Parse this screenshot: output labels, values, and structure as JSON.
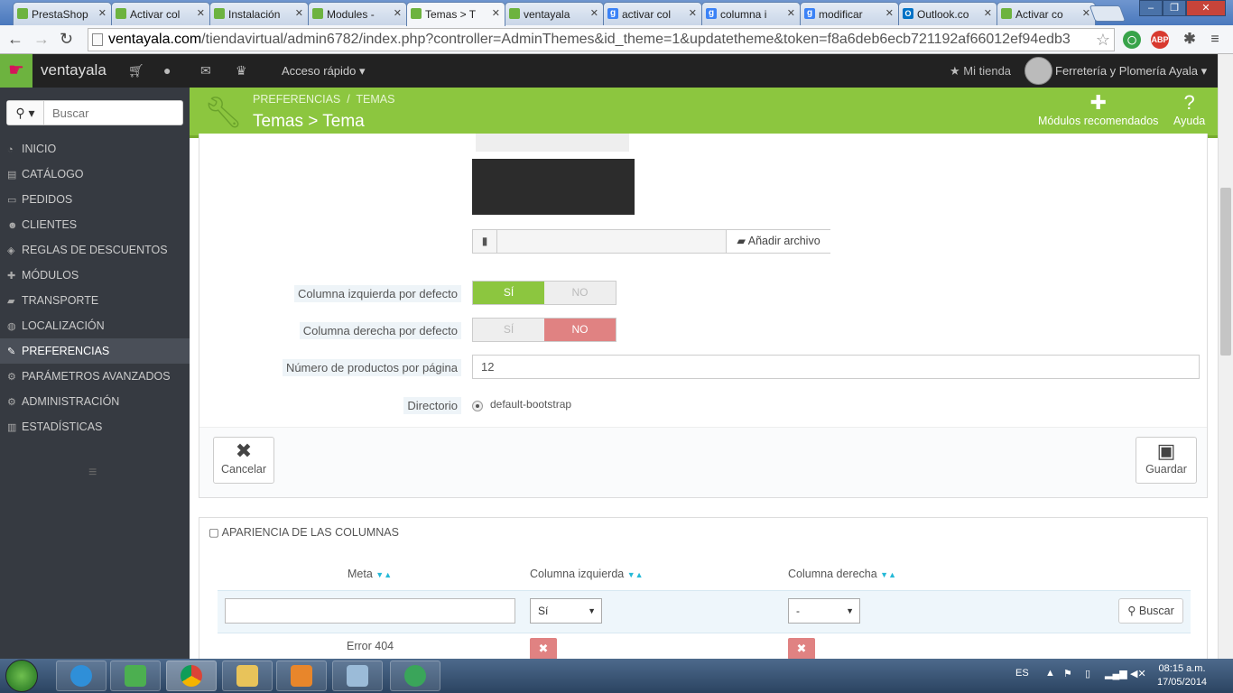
{
  "browser": {
    "tabs": [
      {
        "label": "PrestaShop",
        "favicon": "prestashop-icon",
        "active": false
      },
      {
        "label": "Activar col",
        "favicon": "prestashop-icon",
        "active": false
      },
      {
        "label": "Instalación",
        "favicon": "prestashop-icon",
        "active": false
      },
      {
        "label": "Modules -",
        "favicon": "prestashop-icon",
        "active": false
      },
      {
        "label": "Temas > T",
        "favicon": "prestashop-icon",
        "active": true
      },
      {
        "label": "ventayala",
        "favicon": "prestashop-icon",
        "active": false
      },
      {
        "label": "activar col",
        "favicon": "google-icon",
        "active": false
      },
      {
        "label": "columna i",
        "favicon": "google-icon",
        "active": false
      },
      {
        "label": "modificar",
        "favicon": "google-icon",
        "active": false
      },
      {
        "label": "Outlook.co",
        "favicon": "outlook-icon",
        "active": false
      },
      {
        "label": "Activar co",
        "favicon": "prestashop-icon",
        "active": false
      }
    ],
    "url_domain": "ventayala.com",
    "url_rest": "/tiendavirtual/admin6782/index.php?controller=AdminThemes&id_theme=1&updatetheme&token=f8a6deb6ecb721192af66012ef94edb3",
    "ext_abp": "ABP"
  },
  "header": {
    "shop_name": "ventayala",
    "quick_access": "Acceso rápido",
    "my_shop": "Mi tienda",
    "employee": "Ferretería y Plomería Ayala"
  },
  "sidebar": {
    "search_placeholder": "Buscar",
    "items": [
      {
        "label": "INICIO",
        "icon": "dashboard-icon",
        "active": false
      },
      {
        "label": "CATÁLOGO",
        "icon": "book-icon",
        "active": false
      },
      {
        "label": "PEDIDOS",
        "icon": "credit-card-icon",
        "active": false
      },
      {
        "label": "CLIENTES",
        "icon": "users-icon",
        "active": false
      },
      {
        "label": "REGLAS DE DESCUENTOS",
        "icon": "tag-icon",
        "active": false
      },
      {
        "label": "MÓDULOS",
        "icon": "puzzle-icon",
        "active": false
      },
      {
        "label": "TRANSPORTE",
        "icon": "truck-icon",
        "active": false
      },
      {
        "label": "LOCALIZACIÓN",
        "icon": "globe-icon",
        "active": false
      },
      {
        "label": "PREFERENCIAS",
        "icon": "wrench-icon",
        "active": true
      },
      {
        "label": "PARÁMETROS AVANZADOS",
        "icon": "cogs-icon",
        "active": false
      },
      {
        "label": "ADMINISTRACIÓN",
        "icon": "cog-icon",
        "active": false
      },
      {
        "label": "ESTADÍSTICAS",
        "icon": "bar-chart-icon",
        "active": false
      }
    ]
  },
  "page": {
    "breadcrumb_1": "PREFERENCIAS",
    "breadcrumb_2": "TEMAS",
    "title": "Temas > Tema",
    "toolbar_modules": "Módulos recomendados",
    "toolbar_help": "Ayuda"
  },
  "form": {
    "add_file": "Añadir archivo",
    "left_column_label": "Columna izquierda por defecto",
    "right_column_label": "Columna derecha por defecto",
    "yes": "SÍ",
    "no": "NO",
    "left_column_value": "SÍ",
    "right_column_value": "NO",
    "products_per_page_label": "Número de productos por página",
    "products_per_page_value": "12",
    "directory_label": "Directorio",
    "directory_value": "default-bootstrap",
    "cancel": "Cancelar",
    "save": "Guardar"
  },
  "columns_panel": {
    "title": "APARIENCIA DE LAS COLUMNAS",
    "col_meta": "Meta",
    "col_left": "Columna izquierda",
    "col_right": "Columna derecha",
    "filter_left_value": "Sí",
    "filter_right_value": "-",
    "search_button": "Buscar",
    "rows": [
      {
        "meta": "Error 404"
      }
    ]
  },
  "taskbar": {
    "language": "ES",
    "time": "08:15 a.m.",
    "date": "17/05/2014"
  },
  "colors": {
    "brand_green": "#8cc63f",
    "sidebar_bg": "#363a41",
    "no_red": "#e08282",
    "accent_blue": "#25b9d7"
  }
}
